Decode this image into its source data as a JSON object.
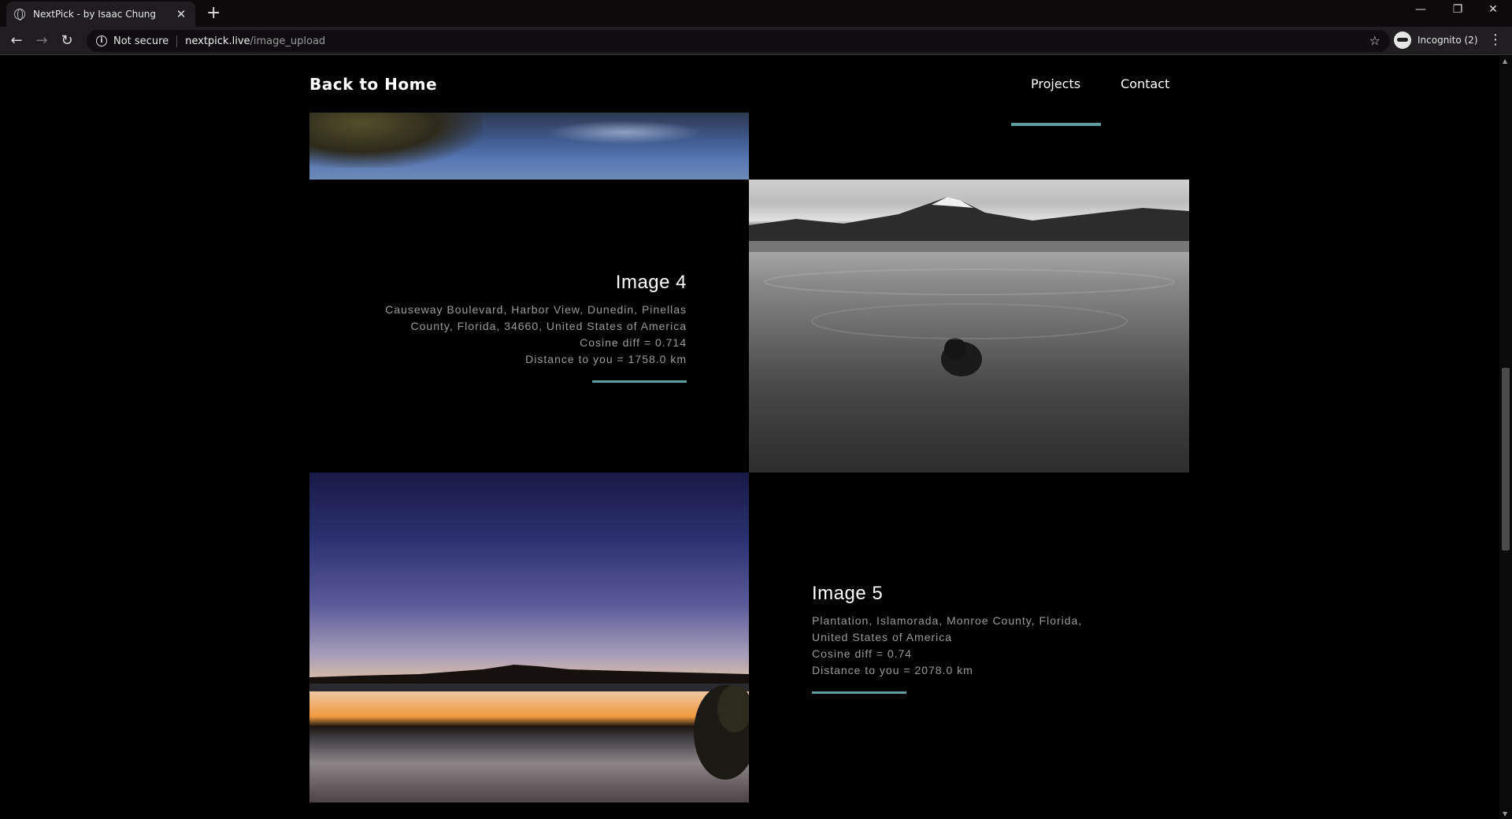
{
  "browser": {
    "tab_title": "NextPick - by Isaac Chung",
    "tab_close": "✕",
    "new_tab": "+",
    "security_label": "Not secure",
    "url_host": "nextpick.live",
    "url_path": "/image_upload",
    "profile_label": "Incognito (2)",
    "window_controls": [
      "—",
      "❐",
      "✕"
    ]
  },
  "site": {
    "back_home": "Back to Home",
    "nav": {
      "projects": "Projects",
      "contact": "Contact",
      "active": "Projects",
      "accent_color": "#5f9ea0"
    }
  },
  "results": [
    {
      "title": "Image 4",
      "address_line1": "Causeway Boulevard, Harbor View, Dunedin, Pinellas",
      "address_line2": "County, Florida, 34660, United States of America",
      "cosine": "Cosine diff = 0.714",
      "distance": "Distance to you = 1758.0 km"
    },
    {
      "title": "Image 5",
      "address_line1": "Plantation, Islamorada, Monroe County, Florida,",
      "address_line2": "United States of America",
      "cosine": "Cosine diff = 0.74",
      "distance": "Distance to you = 2078.0 km"
    }
  ]
}
